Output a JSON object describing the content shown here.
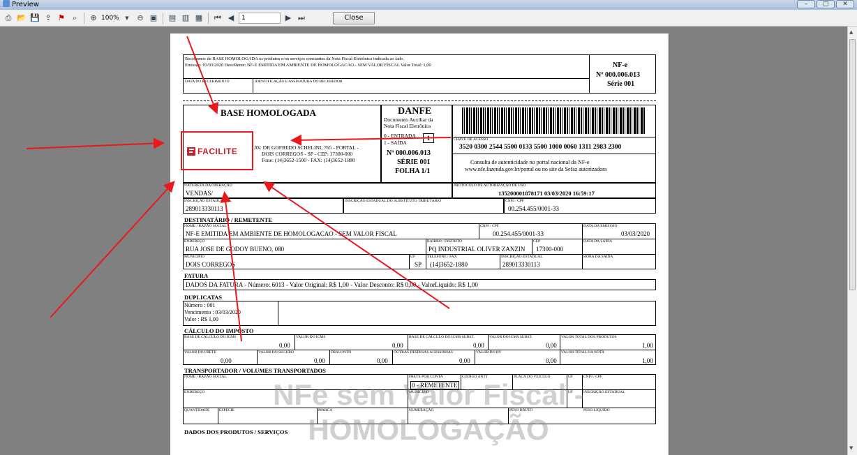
{
  "window": {
    "title": "Preview",
    "min_label": "–",
    "max_label": "▢",
    "close_label": "✕"
  },
  "toolbar": {
    "zoom": "100%",
    "page_number": "1",
    "close_label": "Close"
  },
  "receipt": {
    "text1": "Recebemos de BASE HOMOLOGADA os produtos e/ou serviços constantes da Nota Fiscal Eletrônica indicada ao lado.",
    "text2": "Emissão: 03/03/2020  Dest/Reme: NF-E EMITIDA EM AMBIENTE DE HOMOLOGACAO - SEM VALOR FISCAL  Valor Total: 1,00",
    "date_label": "DATA DO RECEBIMENTO",
    "sign_label": "IDENTIFICAÇÃO E ASSINATURA DO RECEBEDOR",
    "nfe": "NF-e",
    "nfe_num": "Nº 000.006.013",
    "nfe_serie": "Série 001"
  },
  "issuer": {
    "name": "BASE HOMOLOGADA",
    "logo": "FACILITE",
    "address1": "AV. DR GOFREDO SCHELINI, 765 - PORTAL -",
    "address2": "DOIS CORREGOS - SP - CEP: 17300-000",
    "address3": "Fone: (14)3652-1500 - FAX: (14)3652-1880"
  },
  "danfe": {
    "title": "DANFE",
    "sub1": "Documento Auxiliar da",
    "sub2": "Nota Fiscal Eletrônica",
    "entrada": "0 - ENTRADA",
    "saida": "1 - SAÍDA",
    "tipo": "1",
    "numero": "Nº 000.006.013",
    "serie": "SÉRIE 001",
    "folha": "FOLHA 1/1"
  },
  "access": {
    "key_label": "CHAVE DE ACESSO",
    "key": "3520 0300 2544 5500 0133 5500 1000 0060 1311 2983 2300",
    "consult1": "Consulta de autenticidade no portal nacional da NF-e",
    "consult2": "www.nfe.fazenda.gov.br/portal ou no site da Sefaz autorizadora"
  },
  "operation": {
    "nature_label": "NATUREZA DA OPERAÇÃO",
    "nature": "VENDAS/",
    "protocol_label": "PROTOCOLO DE AUTORIZAÇÃO DE USO",
    "protocol": "135200001878171 03/03/2020 16:59:17",
    "ie_label": "INSCRIÇÃO ESTADUAL",
    "ie": "289013330113",
    "iest_label": "INSCRIÇÃO ESTADUAL DO SUBSTITUTO TRIBUTÁRIO",
    "cnpj_label": "CNPJ / CPF",
    "cnpj": "00.254.455/0001-33"
  },
  "recipient": {
    "section": "DESTINATÁRIO / REMETENTE",
    "name_label": "NOME / RAZÃO SOCIAL",
    "name": "NF-E EMITIDA EM AMBIENTE DE HOMOLOGACAO - SEM VALOR FISCAL",
    "cnpj_label": "CNPJ / CPF",
    "cnpj": "00.254.455/0001-33",
    "emission_label": "DATA DA EMISSÃO",
    "emission": "03/03/2020",
    "address_label": "ENDEREÇO",
    "address": "RUA JOSE DE GODOY BUENO, 080",
    "district_label": "BAIRRO / DISTRITO",
    "district": "PQ INDUSTRIAL OLIVER ZANZIN",
    "cep_label": "CEP",
    "cep": "17300-000",
    "exit_label": "DATA DA SAÍDA",
    "city_label": "MUNICÍPIO",
    "city": "DOIS CORREGOS",
    "uf_label": "UF",
    "uf": "SP",
    "phone_label": "TELEFONE / FAX",
    "phone": "(14)3652-1880",
    "ie_label": "INSCRIÇÃO ESTADUAL",
    "ie": "289013330113",
    "hour_label": "HORA DA SAÍDA"
  },
  "invoice": {
    "section": "FATURA",
    "text": "DADOS DA FATURA  -  Número:  6013   -  Valor Original: R$ 1,00   -  Valor Desconto:  R$ 0,00   -  ValorLiquido: R$ 1,00"
  },
  "duplicates": {
    "section": "DUPLICATAS",
    "number": "Número     :  001",
    "due": "Vencimento :  03/03/2020",
    "value": "Valor         :  R$ 1,00"
  },
  "tax": {
    "section": "CÁLCULO DO IMPOSTO",
    "row1": [
      {
        "label": "BASE DE CÁLCULO DO ICMS",
        "value": "0,00"
      },
      {
        "label": "VALOR DO ICMS",
        "value": "0,00"
      },
      {
        "label": "BASE DE CÁLCULO DO ICMS SUBST.",
        "value": "0,00"
      },
      {
        "label": "VALOR DO ICMS SUBST.",
        "value": "0,00"
      },
      {
        "label": "VALOR TOTAL DOS PRODUTOS",
        "value": "1,00"
      }
    ],
    "row2": [
      {
        "label": "VALOR DO FRETE",
        "value": "0,00"
      },
      {
        "label": "VALOR DO SEGURO",
        "value": "0,00"
      },
      {
        "label": "DESCONTO",
        "value": "0,00"
      },
      {
        "label": "OUTRAS DESPESAS ACESSÓRIAS",
        "value": "0,00"
      },
      {
        "label": "VALOR DO IPI",
        "value": "0,00"
      },
      {
        "label": "VALOR TOTAL DA NOTA",
        "value": "1,00"
      }
    ]
  },
  "transport": {
    "section": "TRANSPORTADOR / VOLUMES TRANSPORTADOS",
    "name_label": "NOME / RAZÃO SOCIAL",
    "freight_label": "FRETE POR CONTA",
    "freight": "0 - REMETENTE",
    "antt_label": "CÓDIGO ANTT",
    "plate_label": "PLACA DO VEÍCULO",
    "uf_label": "UF",
    "cnpj_label": "CNPJ / CPF",
    "address_label": "ENDEREÇO",
    "city_label": "MUNICÍPIO",
    "uf2_label": "UF",
    "ie_label": "INSCRIÇÃO ESTADUAL",
    "qty_label": "QUANTIDADE",
    "kind_label": "ESPÉCIE",
    "brand_label": "MARCA",
    "numbering_label": "NUMERAÇÃO",
    "gross_label": "PESO BRUTO",
    "net_label": "PESO LÍQUIDO"
  },
  "products": {
    "section": "DADOS DOS PRODUTOS / SERVIÇOS"
  },
  "watermark": {
    "line1": "NFe sem Valor Fiscal -",
    "line2": "HOMOLOGAÇÃO"
  },
  "colors": {
    "arrow": "#e8181c",
    "highlight": "#e8181c",
    "logo": "#c8202c"
  }
}
